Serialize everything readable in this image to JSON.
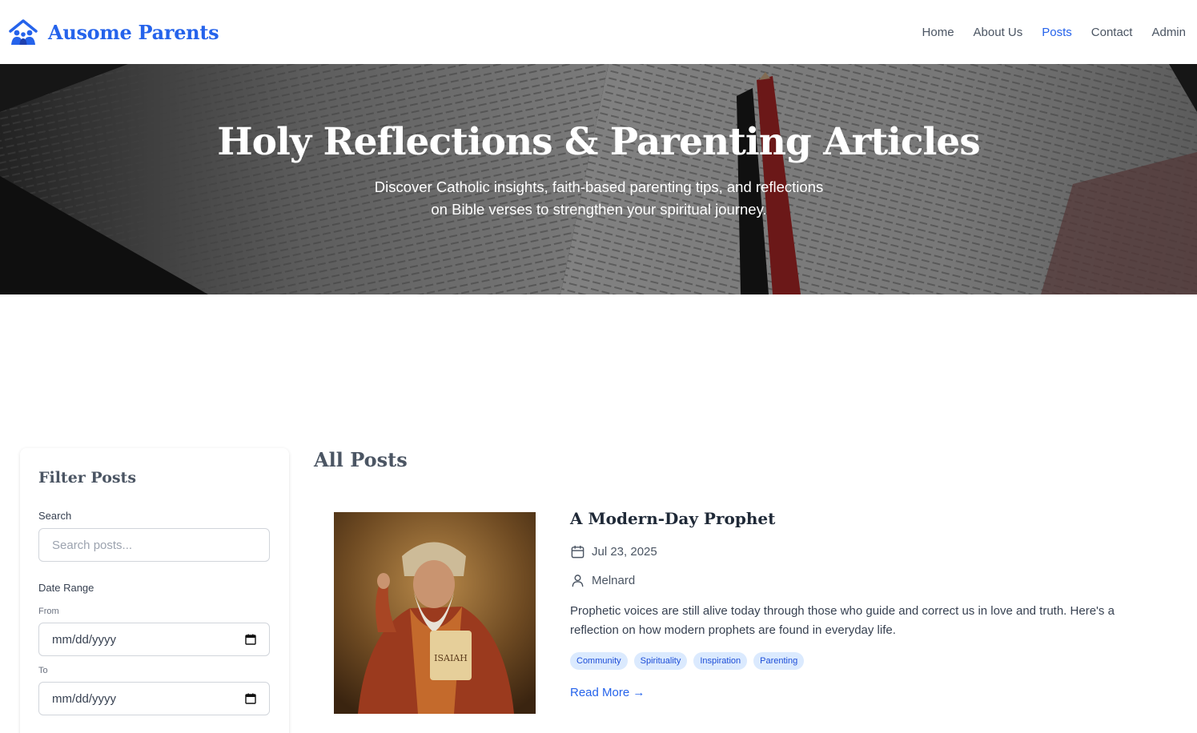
{
  "brand": {
    "name": "Ausome Parents",
    "icon": "family-home-icon",
    "color": "#2563eb"
  },
  "nav": {
    "items": [
      {
        "label": "Home",
        "active": false
      },
      {
        "label": "About Us",
        "active": false
      },
      {
        "label": "Posts",
        "active": true
      },
      {
        "label": "Contact",
        "active": false
      },
      {
        "label": "Admin",
        "active": false
      }
    ]
  },
  "hero": {
    "title": "Holy Reflections & Parenting Articles",
    "subtitle": "Discover Catholic insights, faith-based parenting tips, and reflections on Bible verses to strengthen your spiritual journey."
  },
  "filter": {
    "title": "Filter Posts",
    "search_label": "Search",
    "search_placeholder": "Search posts...",
    "date_range_label": "Date Range",
    "from_label": "From",
    "from_value": "mm/dd/yyyy",
    "to_label": "To",
    "to_value": "mm/dd/yyyy"
  },
  "posts": {
    "heading": "All Posts",
    "items": [
      {
        "title": "A Modern-Day Prophet",
        "date": "Jul 23, 2025",
        "author": "Melnard",
        "excerpt": "Prophetic voices are still alive today through those who guide and correct us in love and truth. Here's a reflection on how modern prophets are found in everyday life.",
        "tags": [
          "Community",
          "Spirituality",
          "Inspiration",
          "Parenting"
        ],
        "read_more": "Read More →",
        "image_scroll_text": "ISAIAH"
      }
    ]
  }
}
